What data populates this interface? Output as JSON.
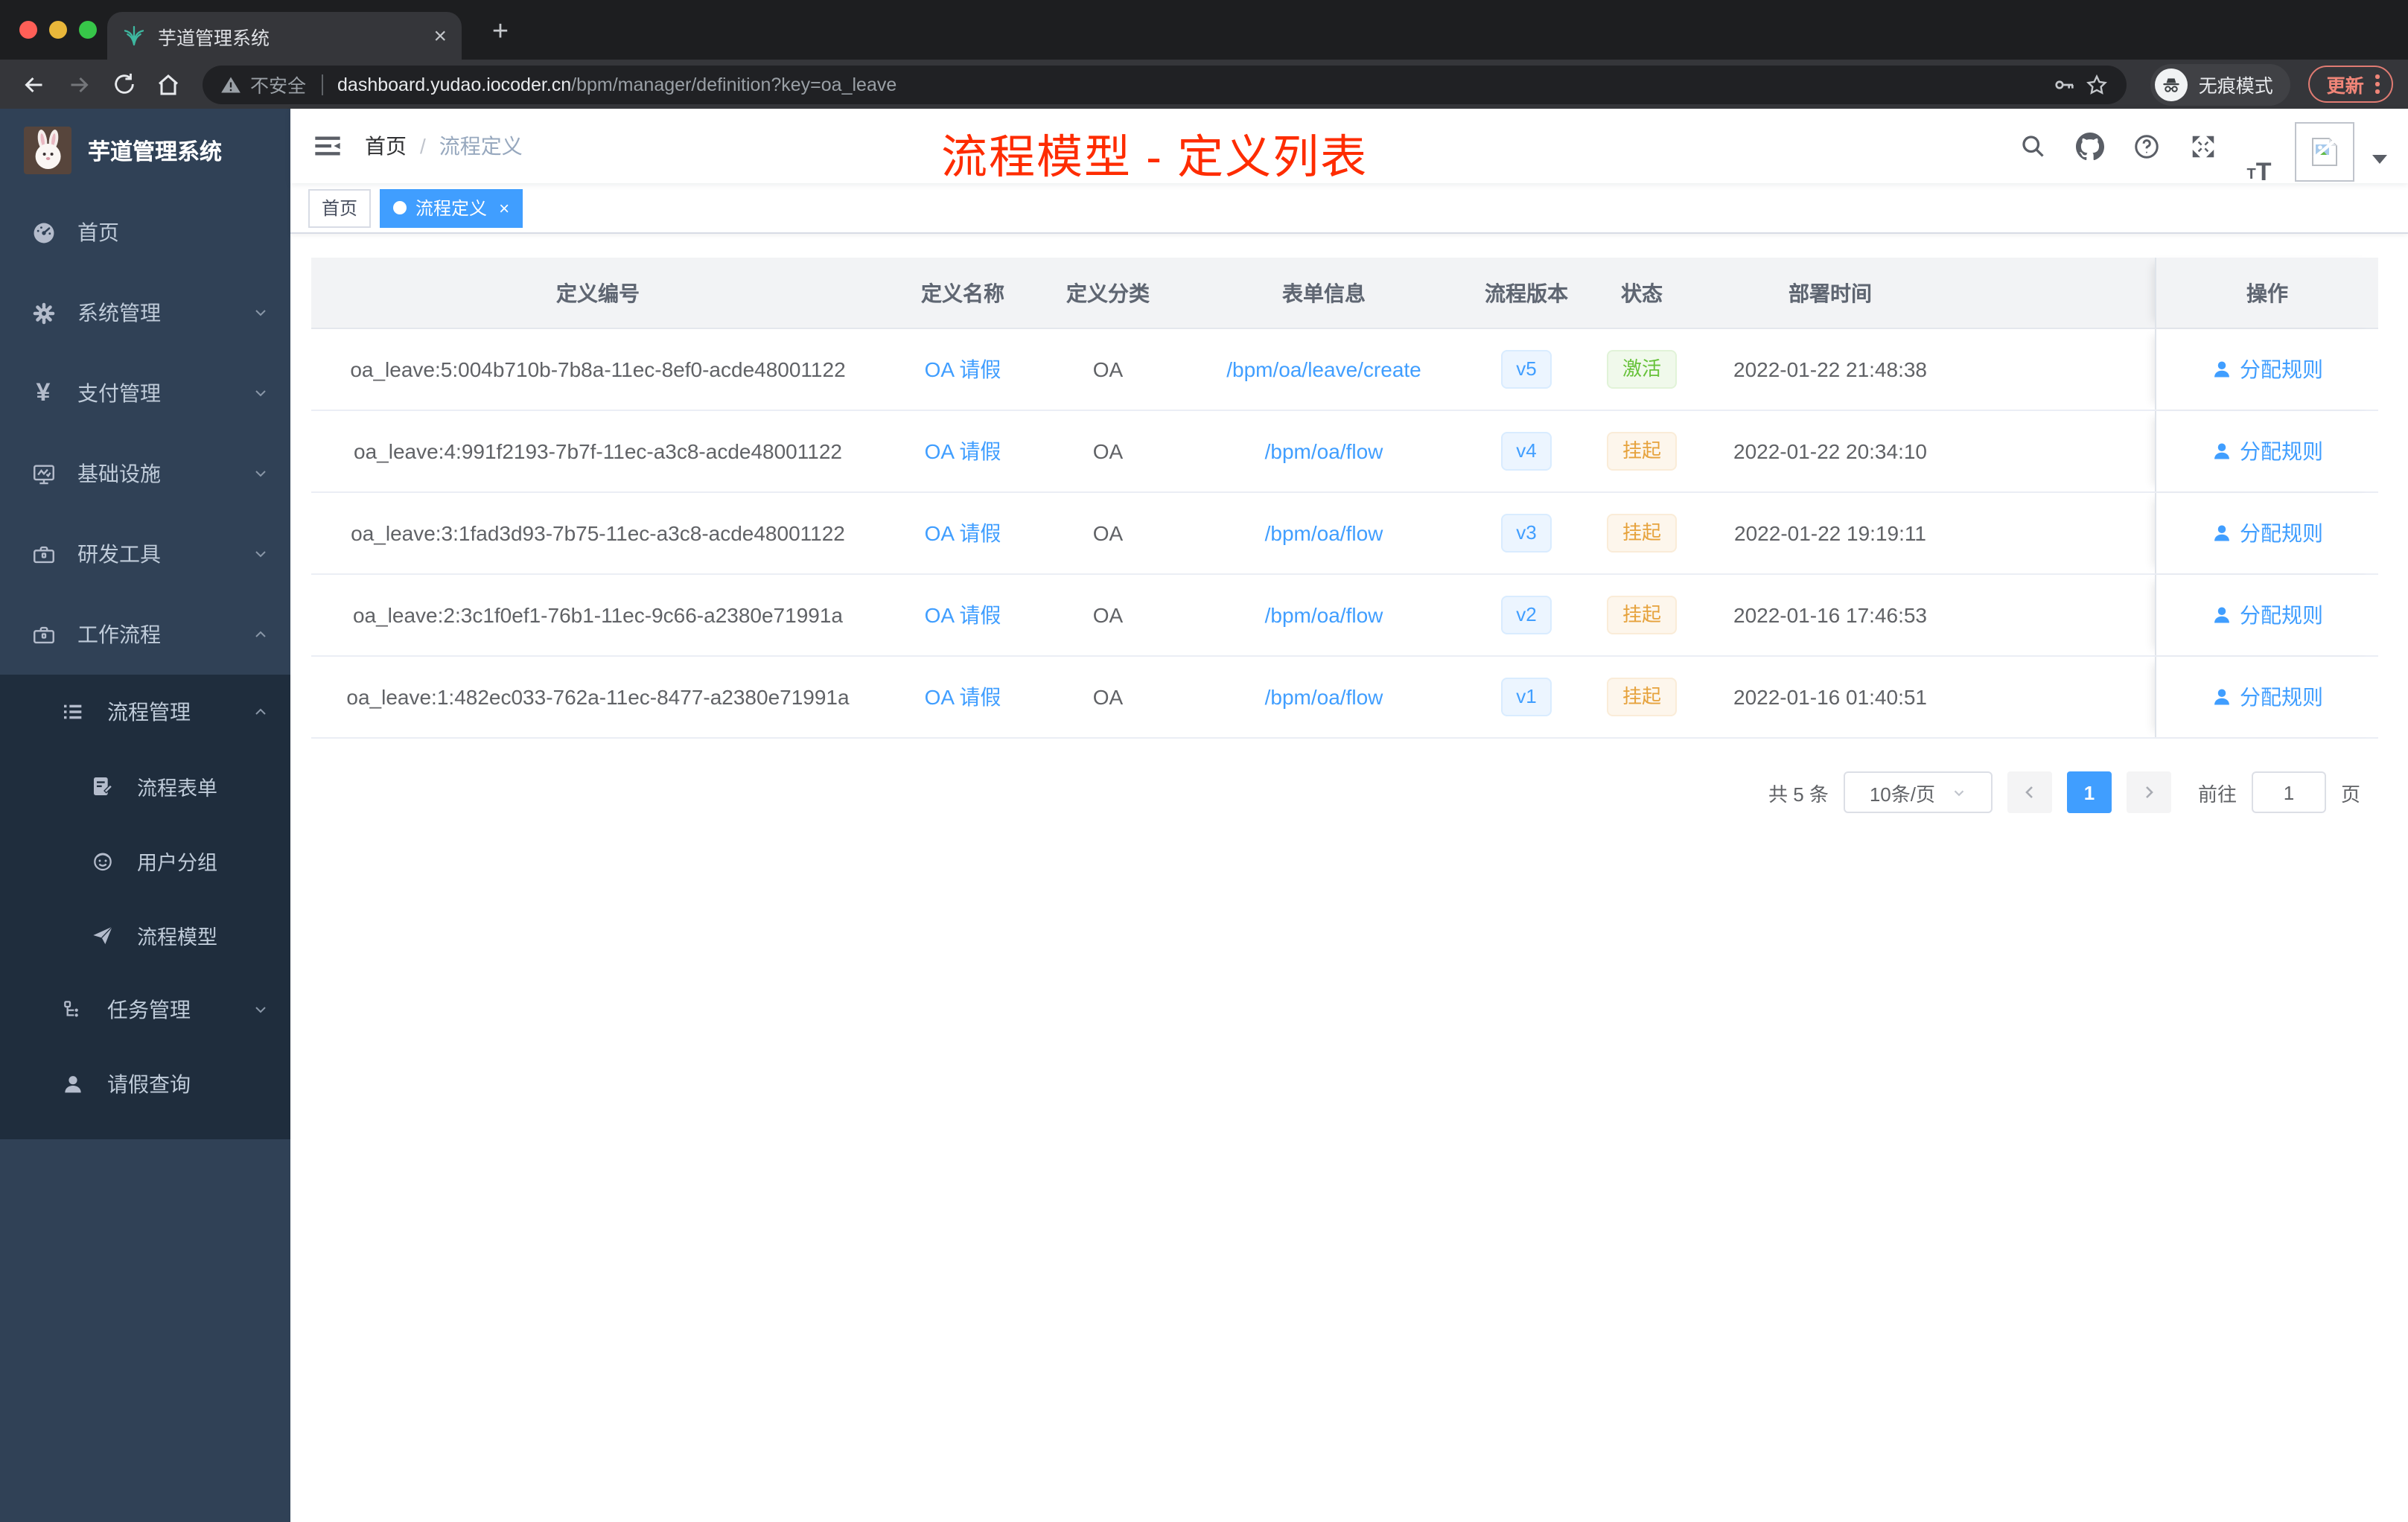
{
  "browser": {
    "tab_title": "芋道管理系统",
    "close_glyph": "×",
    "newtab_glyph": "+",
    "security_label": "不安全",
    "url_domain": "dashboard.yudao.iocoder.cn",
    "url_path": "/bpm/manager/definition?key=oa_leave",
    "incognito_label": "无痕模式",
    "update_label": "更新"
  },
  "sidebar": {
    "logo_title": "芋道管理系统",
    "menu": {
      "home": "首页",
      "system": "系统管理",
      "pay": "支付管理",
      "infra": "基础设施",
      "dev": "研发工具",
      "workflow": "工作流程",
      "process_mgmt": "流程管理",
      "process_form": "流程表单",
      "user_group": "用户分组",
      "process_model": "流程模型",
      "task_mgmt": "任务管理",
      "leave_query": "请假查询"
    }
  },
  "navbar": {
    "breadcrumb_home": "首页",
    "breadcrumb_sep": "/",
    "breadcrumb_current": "流程定义",
    "annotation": "流程模型 - 定义列表"
  },
  "tags": {
    "home": "首页",
    "current": "流程定义",
    "close_glyph": "×"
  },
  "table": {
    "columns": [
      "定义编号",
      "定义名称",
      "定义分类",
      "表单信息",
      "流程版本",
      "状态",
      "部署时间",
      "操作"
    ],
    "rows": [
      {
        "id": "oa_leave:5:004b710b-7b8a-11ec-8ef0-acde48001122",
        "name": "OA 请假",
        "category": "OA",
        "form": "/bpm/oa/leave/create",
        "version": "v5",
        "status": "激活",
        "deployed": "2022-01-22 21:48:38",
        "action": "分配规则"
      },
      {
        "id": "oa_leave:4:991f2193-7b7f-11ec-a3c8-acde48001122",
        "name": "OA 请假",
        "category": "OA",
        "form": "/bpm/oa/flow",
        "version": "v4",
        "status": "挂起",
        "deployed": "2022-01-22 20:34:10",
        "action": "分配规则"
      },
      {
        "id": "oa_leave:3:1fad3d93-7b75-11ec-a3c8-acde48001122",
        "name": "OA 请假",
        "category": "OA",
        "form": "/bpm/oa/flow",
        "version": "v3",
        "status": "挂起",
        "deployed": "2022-01-22 19:19:11",
        "action": "分配规则"
      },
      {
        "id": "oa_leave:2:3c1f0ef1-76b1-11ec-9c66-a2380e71991a",
        "name": "OA 请假",
        "category": "OA",
        "form": "/bpm/oa/flow",
        "version": "v2",
        "status": "挂起",
        "deployed": "2022-01-16 17:46:53",
        "action": "分配规则"
      },
      {
        "id": "oa_leave:1:482ec033-762a-11ec-8477-a2380e71991a",
        "name": "OA 请假",
        "category": "OA",
        "form": "/bpm/oa/flow",
        "version": "v1",
        "status": "挂起",
        "deployed": "2022-01-16 01:40:51",
        "action": "分配规则"
      }
    ]
  },
  "pagination": {
    "total": "共 5 条",
    "page_size": "10条/页",
    "current_page": "1",
    "goto_label": "前往",
    "goto_value": "1",
    "page_unit": "页"
  },
  "colors": {
    "accent_blue": "#409eff",
    "success_green": "#67c23a",
    "warning_orange": "#e6a23c",
    "annotation_red": "#fe2c00",
    "sidebar_bg": "#304156",
    "submenu_bg": "#1f2d3d"
  }
}
